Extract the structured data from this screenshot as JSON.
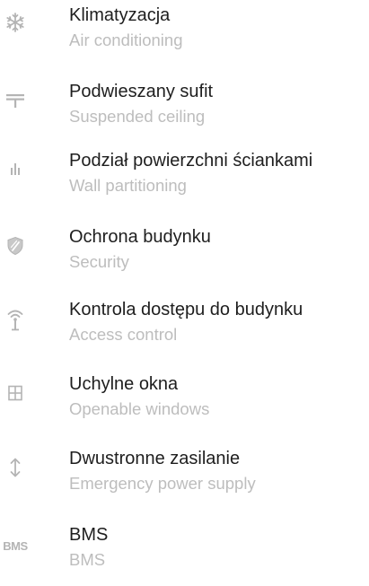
{
  "features": [
    {
      "icon": "snowflake-icon",
      "title": "Klimatyzacja",
      "subtitle": "Air conditioning"
    },
    {
      "icon": "suspended-ceiling-icon",
      "title": "Podwieszany sufit",
      "subtitle": "Suspended ceiling"
    },
    {
      "icon": "wall-partition-icon",
      "title": "Podział powierzchni ściankami",
      "subtitle": "Wall partitioning"
    },
    {
      "icon": "shield-icon",
      "title": "Ochrona budynku",
      "subtitle": "Security"
    },
    {
      "icon": "access-antenna-icon",
      "title": "Kontrola dostępu do budynku",
      "subtitle": "Access control"
    },
    {
      "icon": "window-icon",
      "title": "Uchylne okna",
      "subtitle": "Openable windows"
    },
    {
      "icon": "up-down-arrow-icon",
      "title": "Dwustronne zasilanie",
      "subtitle": "Emergency power supply"
    },
    {
      "icon": "bms-icon",
      "title": "BMS",
      "subtitle": "BMS",
      "icon_text": "BMS"
    }
  ],
  "colors": {
    "title": "#1e1e1e",
    "subtitle": "#bdbdbd",
    "icon": "#b4b4b4"
  }
}
